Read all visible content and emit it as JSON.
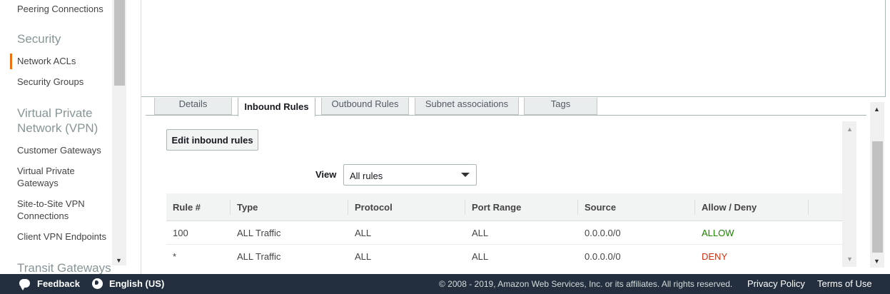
{
  "sidebar": {
    "items": [
      {
        "label": "Peering Connections"
      },
      {
        "heading": "Security"
      },
      {
        "label": "Network ACLs",
        "active": true
      },
      {
        "label": "Security Groups"
      },
      {
        "heading": "Virtual Private Network (VPN)"
      },
      {
        "label": "Customer Gateways"
      },
      {
        "label": "Virtual Private Gateways"
      },
      {
        "label": "Site-to-Site VPN Connections"
      },
      {
        "label": "Client VPN Endpoints"
      },
      {
        "heading": "Transit Gateways"
      }
    ],
    "peering": "Peering Connections",
    "security_heading": "Security",
    "network_acls": "Network ACLs",
    "security_groups": "Security Groups",
    "vpn_heading_1": "Virtual Private",
    "vpn_heading_2": "Network (VPN)",
    "customer_gateways": "Customer Gateways",
    "vpg_1": "Virtual Private",
    "vpg_2": "Gateways",
    "s2s_1": "Site-to-Site VPN",
    "s2s_2": "Connections",
    "client_vpn": "Client VPN Endpoints",
    "transit_heading": "Transit Gateways"
  },
  "tabs": {
    "details": "Details",
    "inbound": "Inbound Rules",
    "outbound": "Outbound Rules",
    "subnet": "Subnet associations",
    "tags": "Tags",
    "active": "inbound"
  },
  "content": {
    "edit_button": "Edit inbound rules",
    "view_label": "View",
    "view_value": "All rules"
  },
  "table": {
    "headers": [
      "Rule #",
      "Type",
      "Protocol",
      "Port Range",
      "Source",
      "Allow / Deny"
    ],
    "rows": [
      [
        "100",
        "ALL Traffic",
        "ALL",
        "ALL",
        "0.0.0.0/0",
        "ALLOW"
      ],
      [
        "*",
        "ALL Traffic",
        "ALL",
        "ALL",
        "0.0.0.0/0",
        "DENY"
      ]
    ]
  },
  "footer": {
    "feedback": "Feedback",
    "language": "English (US)",
    "copyright": "© 2008 - 2019, Amazon Web Services, Inc. or its affiliates. All rights reserved.",
    "privacy": "Privacy Policy",
    "terms": "Terms of Use"
  },
  "colors": {
    "accent": "#ec7211",
    "allow": "#1d8102",
    "deny": "#d13212",
    "footer_bg": "#232f3e"
  }
}
